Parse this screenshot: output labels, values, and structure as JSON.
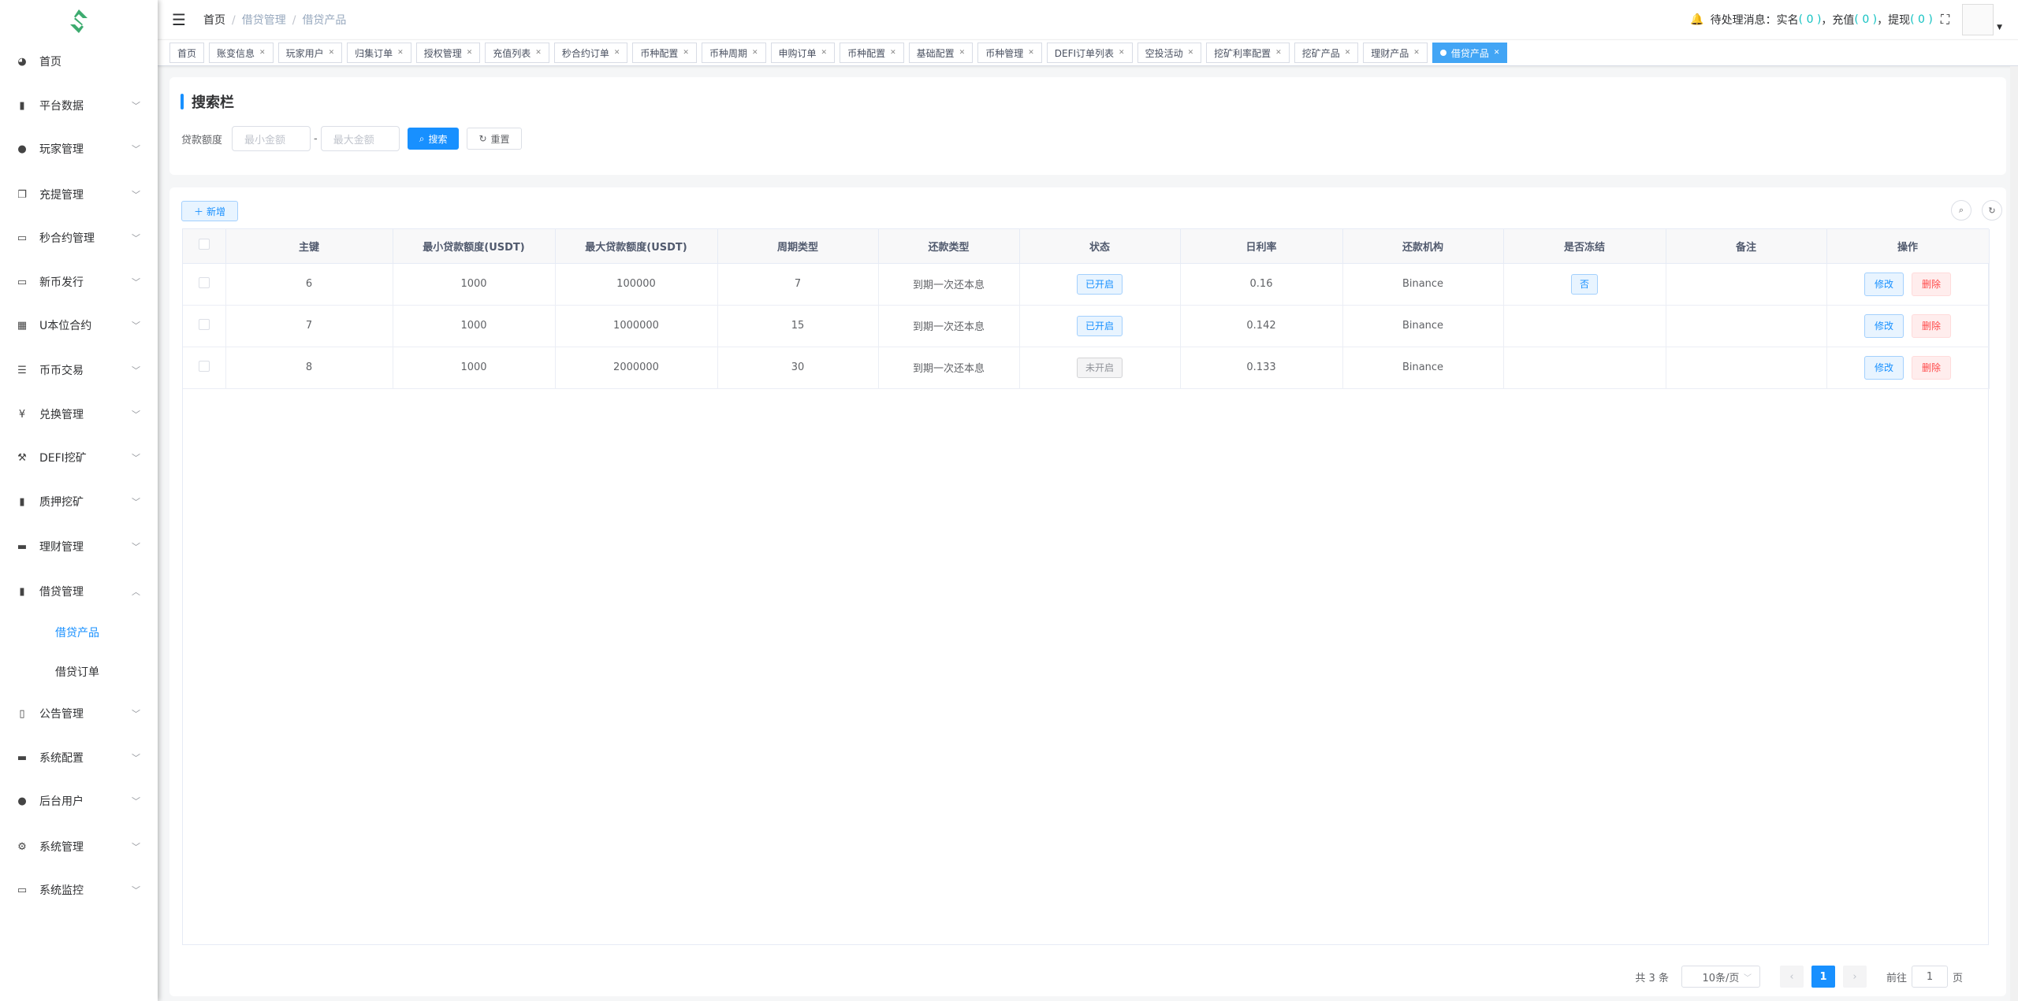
{
  "sidebar": {
    "items": [
      {
        "label": "首页",
        "icon": "dashboard-icon"
      },
      {
        "label": "平台数据",
        "icon": "book-icon"
      },
      {
        "label": "玩家管理",
        "icon": "user-icon"
      },
      {
        "label": "充提管理",
        "icon": "documents-icon"
      },
      {
        "label": "秒合约管理",
        "icon": "monitor-icon"
      },
      {
        "label": "新币发行",
        "icon": "card-icon"
      },
      {
        "label": "U本位合约",
        "icon": "grid-icon"
      },
      {
        "label": "币币交易",
        "icon": "list-icon"
      },
      {
        "label": "兑换管理",
        "icon": "yen-icon"
      },
      {
        "label": "DEFI挖矿",
        "icon": "pickaxe-icon"
      },
      {
        "label": "质押挖矿",
        "icon": "bar-chart-icon"
      },
      {
        "label": "理财管理",
        "icon": "wallet-icon"
      },
      {
        "label": "借贷管理",
        "icon": "book-icon"
      },
      {
        "label": "公告管理",
        "icon": "open-book-icon"
      },
      {
        "label": "系统配置",
        "icon": "wallet-icon"
      },
      {
        "label": "后台用户",
        "icon": "users-icon"
      },
      {
        "label": "系统管理",
        "icon": "gear-icon"
      },
      {
        "label": "系统监控",
        "icon": "monitor-icon"
      }
    ],
    "sub_items": [
      "借贷产品",
      "借贷订单"
    ]
  },
  "header": {
    "breadcrumb": [
      "首页",
      "借贷管理",
      "借贷产品"
    ],
    "pending_label": "待处理消息：",
    "realname_label": "实名",
    "realname_count": "( 0 )",
    "recharge_label": "，充值",
    "recharge_count": "( 0 )",
    "withdraw_label": "，提现",
    "withdraw_count": "( 0 )"
  },
  "tags": [
    "首页",
    "账变信息",
    "玩家用户",
    "归集订单",
    "授权管理",
    "充值列表",
    "秒合约订单",
    "币种配置",
    "币种周期",
    "申购订单",
    "币种配置",
    "基础配置",
    "币种管理",
    "DEFI订单列表",
    "空投活动",
    "挖矿利率配置",
    "挖矿产品",
    "理财产品",
    "借贷产品"
  ],
  "search": {
    "title": "搜索栏",
    "amount_label": "贷款额度",
    "min_placeholder": "最小金额",
    "max_placeholder": "最大金额",
    "dash": "-",
    "search_label": "搜索",
    "reset_label": "重置"
  },
  "table": {
    "add_label": "新增",
    "columns": [
      "主键",
      "最小贷款额度(USDT)",
      "最大贷款额度(USDT)",
      "周期类型",
      "还款类型",
      "状态",
      "日利率",
      "还款机构",
      "是否冻结",
      "备注",
      "操作"
    ],
    "rows": [
      {
        "id": "6",
        "min": "1000",
        "max": "100000",
        "cycle": "7",
        "repay": "到期一次还本息",
        "status": "已开启",
        "status_on": true,
        "rate": "0.16",
        "org": "Binance",
        "frozen": "否",
        "remark": ""
      },
      {
        "id": "7",
        "min": "1000",
        "max": "1000000",
        "cycle": "15",
        "repay": "到期一次还本息",
        "status": "已开启",
        "status_on": true,
        "rate": "0.142",
        "org": "Binance",
        "frozen": "",
        "remark": ""
      },
      {
        "id": "8",
        "min": "1000",
        "max": "2000000",
        "cycle": "30",
        "repay": "到期一次还本息",
        "status": "未开启",
        "status_on": false,
        "rate": "0.133",
        "org": "Binance",
        "frozen": "",
        "remark": ""
      }
    ],
    "edit_label": "修改",
    "delete_label": "删除"
  },
  "pagination": {
    "total": "共 3 条",
    "page_size": "10条/页",
    "current": "1",
    "goto_label": "前往",
    "goto_value": "1",
    "page_suffix": "页"
  },
  "colors": {
    "primary": "#1890ff",
    "active_tag": "#42a5f5",
    "danger": "#ff4949",
    "logo": "#3dab6f"
  }
}
